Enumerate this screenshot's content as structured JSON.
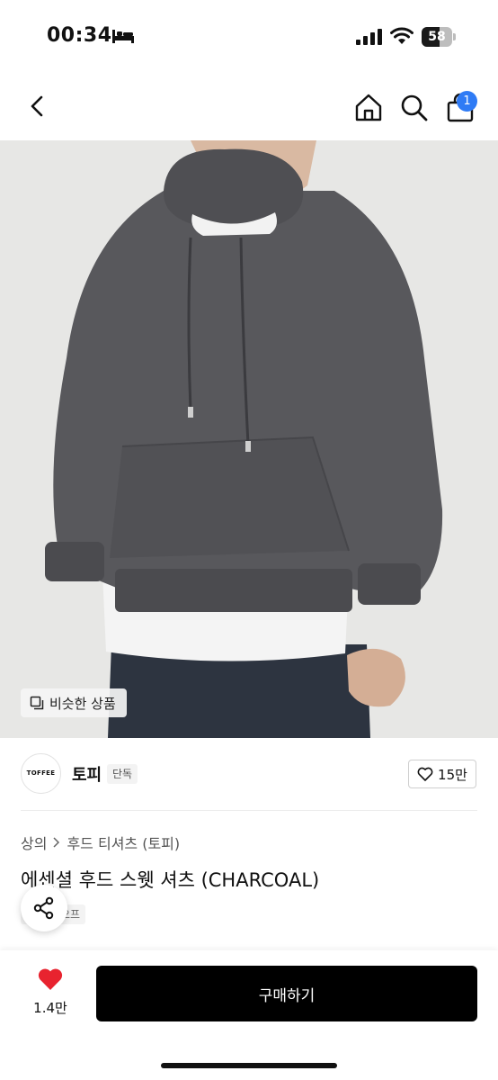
{
  "status_bar": {
    "time": "00:34",
    "battery": "58",
    "battery_fraction": 0.58
  },
  "nav": {
    "cart_count": "1"
  },
  "similar_products_label": "비슷한 상품",
  "brand": {
    "logo_text": "TOFFEE",
    "name": "토피",
    "badge": "단독",
    "likes": "15만"
  },
  "breadcrumb": {
    "items": [
      "상의",
      "후드 티셔츠 (토피)"
    ]
  },
  "product": {
    "title": "에센셜 후드 스웻 셔츠 (CHARCOAL)",
    "tag": "오프"
  },
  "bottom_bar": {
    "likes": "1.4만",
    "buy_label": "구매하기"
  },
  "colors": {
    "accent_badge": "#2f7bf5",
    "buy_button": "#000000",
    "like_heart": "#e8232f",
    "hoodie": "#55555a"
  },
  "icons": [
    "bed-icon",
    "signal-icon",
    "wifi-icon",
    "back-icon",
    "home-icon",
    "search-icon",
    "cart-icon",
    "similar-icon",
    "heart-outline-icon",
    "chevron-right-icon",
    "share-icon",
    "heart-filled-icon"
  ]
}
